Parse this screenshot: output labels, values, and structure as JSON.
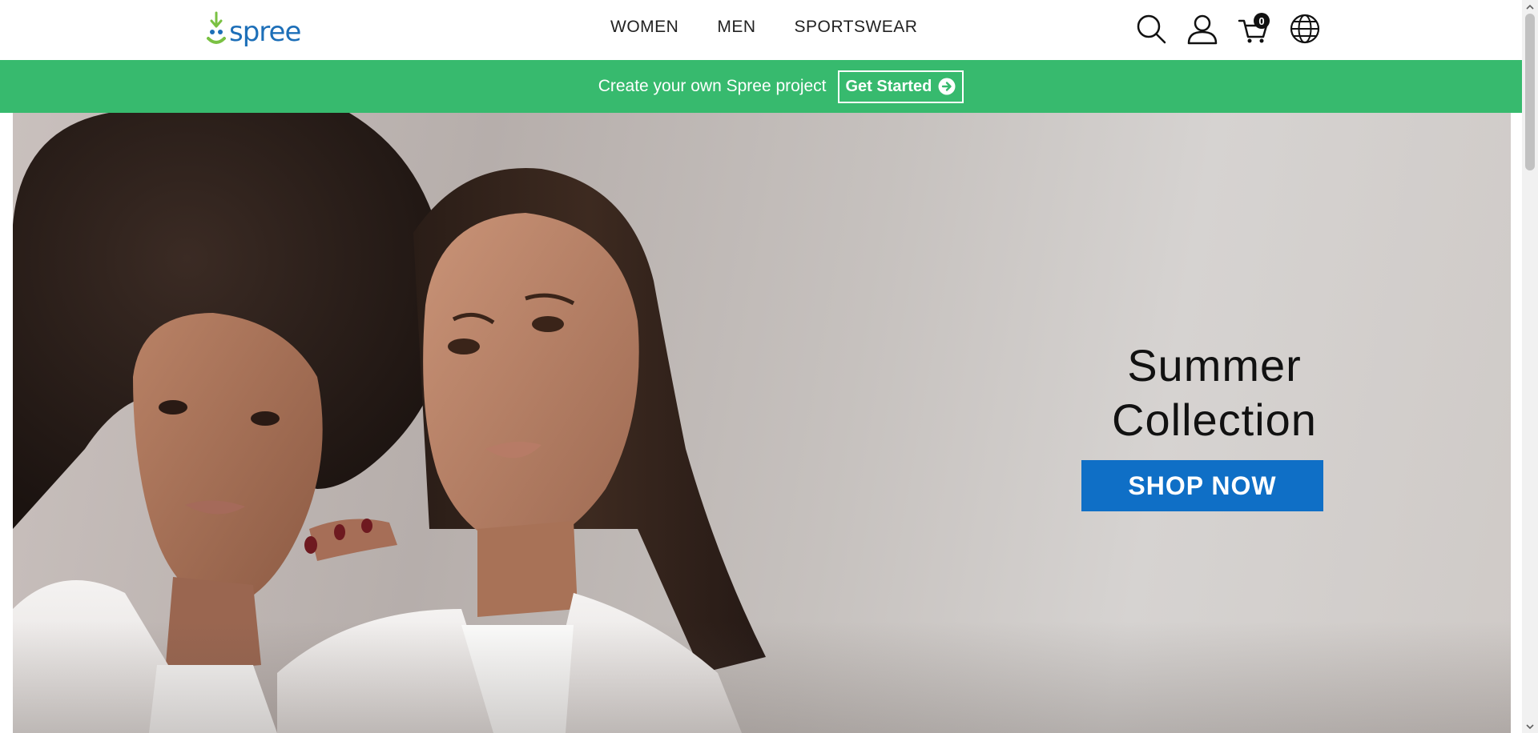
{
  "header": {
    "logo_text": "spree",
    "nav": [
      {
        "label": "WOMEN"
      },
      {
        "label": "MEN"
      },
      {
        "label": "SPORTSWEAR"
      }
    ],
    "icons": [
      "search-icon",
      "account-icon",
      "cart-icon",
      "globe-icon"
    ],
    "cart_count": "0"
  },
  "promo": {
    "text": "Create your own Spree project",
    "button_label": "Get Started"
  },
  "hero": {
    "title_line1": "Summer",
    "title_line2": "Collection",
    "cta_label": "SHOP NOW"
  },
  "colors": {
    "promo_bg": "#37ba6e",
    "cta_bg": "#0f6fc6",
    "logo_blue": "#1d6fb8",
    "logo_green": "#7ac143"
  }
}
